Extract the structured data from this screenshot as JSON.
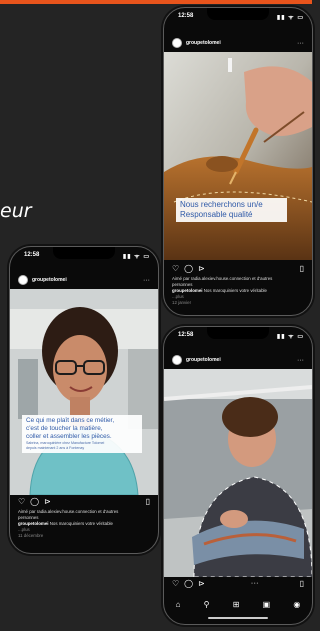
{
  "background_text": "eur",
  "phone1": {
    "time": "12:58",
    "status_icons": "▮▮ ᯤ ▭",
    "username": "groupetolomei",
    "more": "···",
    "overlay": [
      "Nous recherchons un/e",
      "Responsable qualité"
    ],
    "caption_line1": "Aimé par radia.alexiev.house.connection et d'autres",
    "caption_line2": "personnes",
    "caption_user": "groupetolomei",
    "caption_text": "Nos maroquiniers votre véritable",
    "caption_line3": "...plus",
    "date": "12 janvier"
  },
  "phone2": {
    "time": "12:58",
    "status_icons": "▮▮ ᯤ ▭",
    "username": "groupetolomei",
    "more": "···",
    "overlay": [
      "Ce qui me plaît dans ce métier,",
      "c'est de toucher la matière,",
      "coller et assembler les pièces."
    ],
    "overlay_small": [
      "Sabrina, maroquinière chez Manufacture Tolomei",
      "depuis maintenant 2 ans à Fontenay"
    ],
    "caption_line1": "Aimé par radia.alexiev.house.connection et d'autres",
    "caption_line2": "personnes",
    "caption_user": "groupetolomei",
    "caption_text": "Nos maroquiniers votre véritable",
    "caption_line3": "...plus",
    "date": "11 décembre"
  },
  "phone3": {
    "time": "12:58",
    "status_icons": "▮▮ ᯤ ▭",
    "username": "groupetolomei",
    "more": "···",
    "carousel_dots": "● ● ●"
  },
  "icons": {
    "heart": "♡",
    "comment": "◯",
    "share": "⊳",
    "bookmark": "▯",
    "home": "⌂",
    "search": "⚲",
    "add": "⊞",
    "reels": "▣",
    "profile": "◉"
  },
  "accent_colors": {
    "top_bar": "#e8541c",
    "overlay_text": "#2f5aa8",
    "background": "#242424"
  }
}
